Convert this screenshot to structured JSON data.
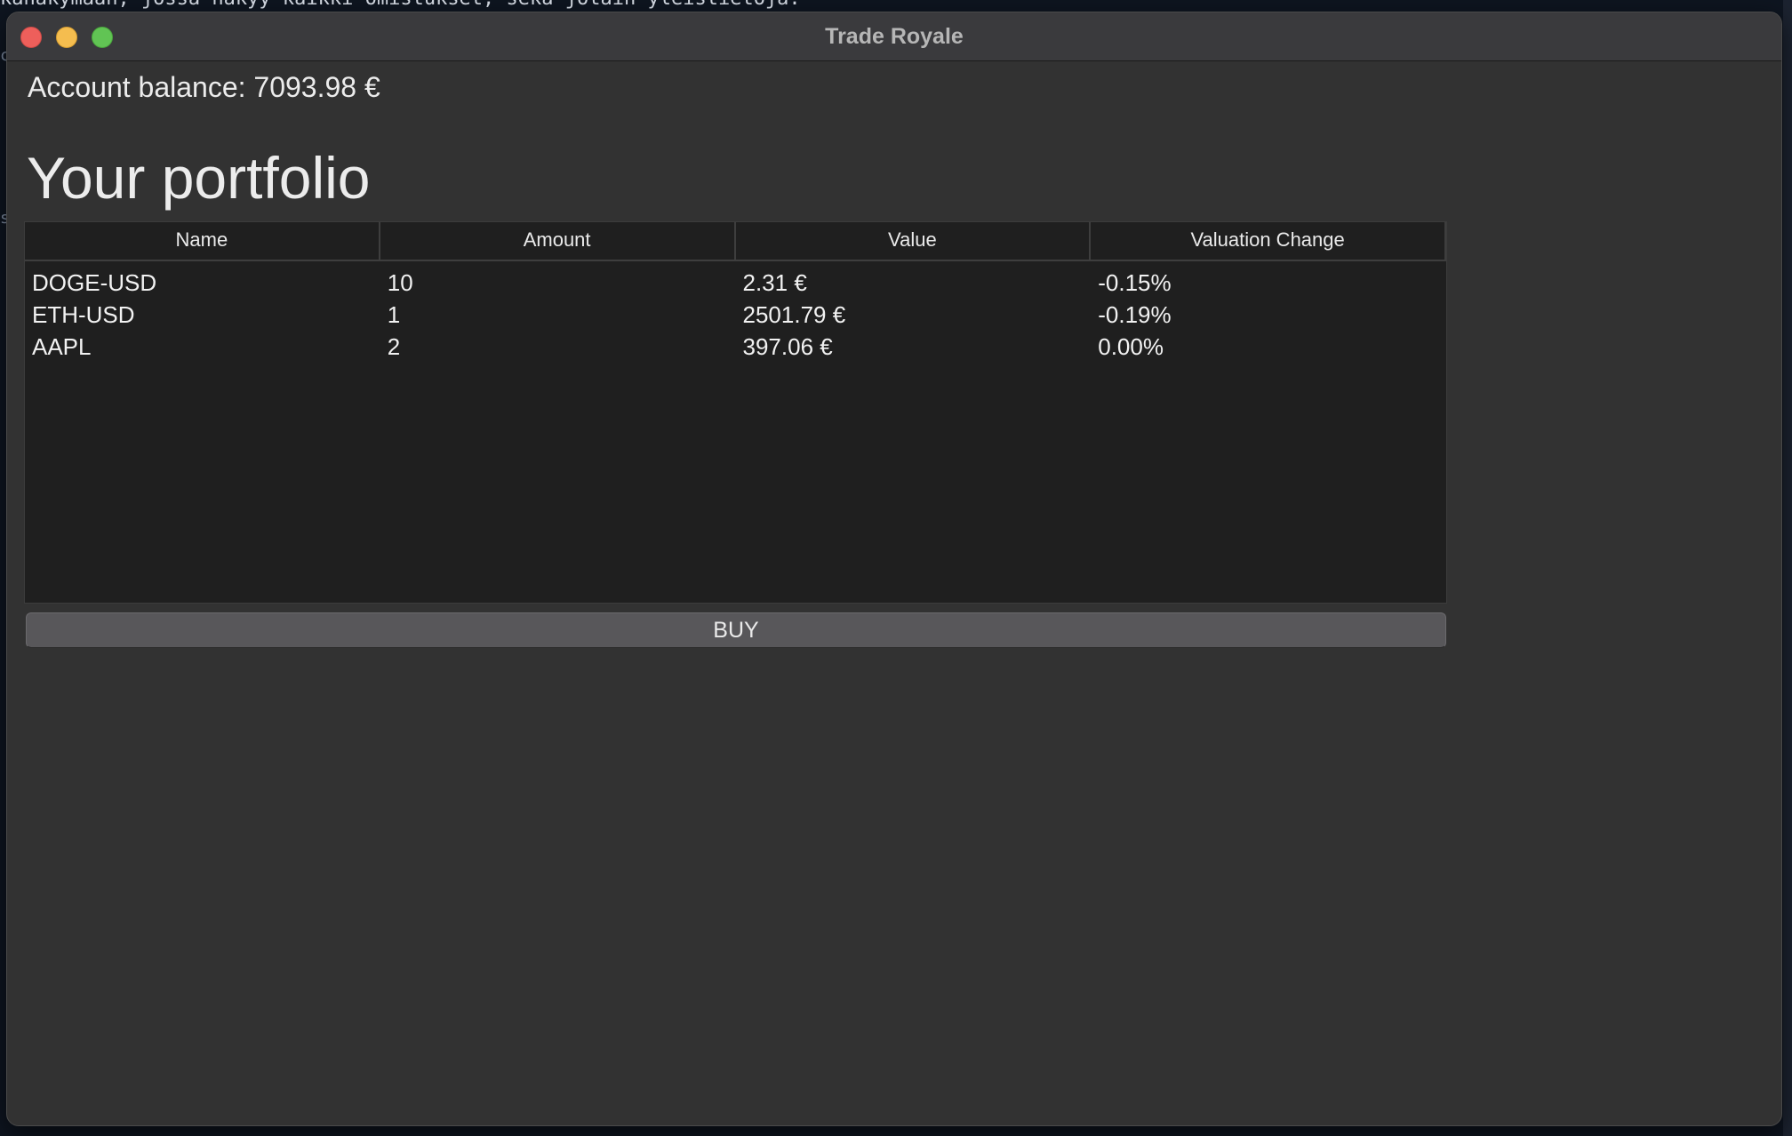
{
  "window": {
    "title": "Trade Royale"
  },
  "account": {
    "balance_text": "Account balance: 7093.98 €"
  },
  "portfolio": {
    "heading": "Your portfolio",
    "columns": [
      "Name",
      "Amount",
      "Value",
      "Valuation Change"
    ],
    "rows": [
      {
        "name": "DOGE-USD",
        "amount": "10",
        "value": "2.31 €",
        "change": "-0.15%"
      },
      {
        "name": "ETH-USD",
        "amount": "1",
        "value": "2501.79 €",
        "change": "-0.19%"
      },
      {
        "name": "AAPL",
        "amount": "2",
        "value": "397.06 €",
        "change": "0.00%"
      }
    ]
  },
  "actions": {
    "buy_label": "BUY"
  },
  "colors": {
    "window_bg": "#323232",
    "table_bg": "#1f1f1f",
    "button_bg": "#58575a",
    "traffic_close": "#ee5f5b",
    "traffic_minimize": "#f5bd4f",
    "traffic_zoom": "#61c454"
  }
}
